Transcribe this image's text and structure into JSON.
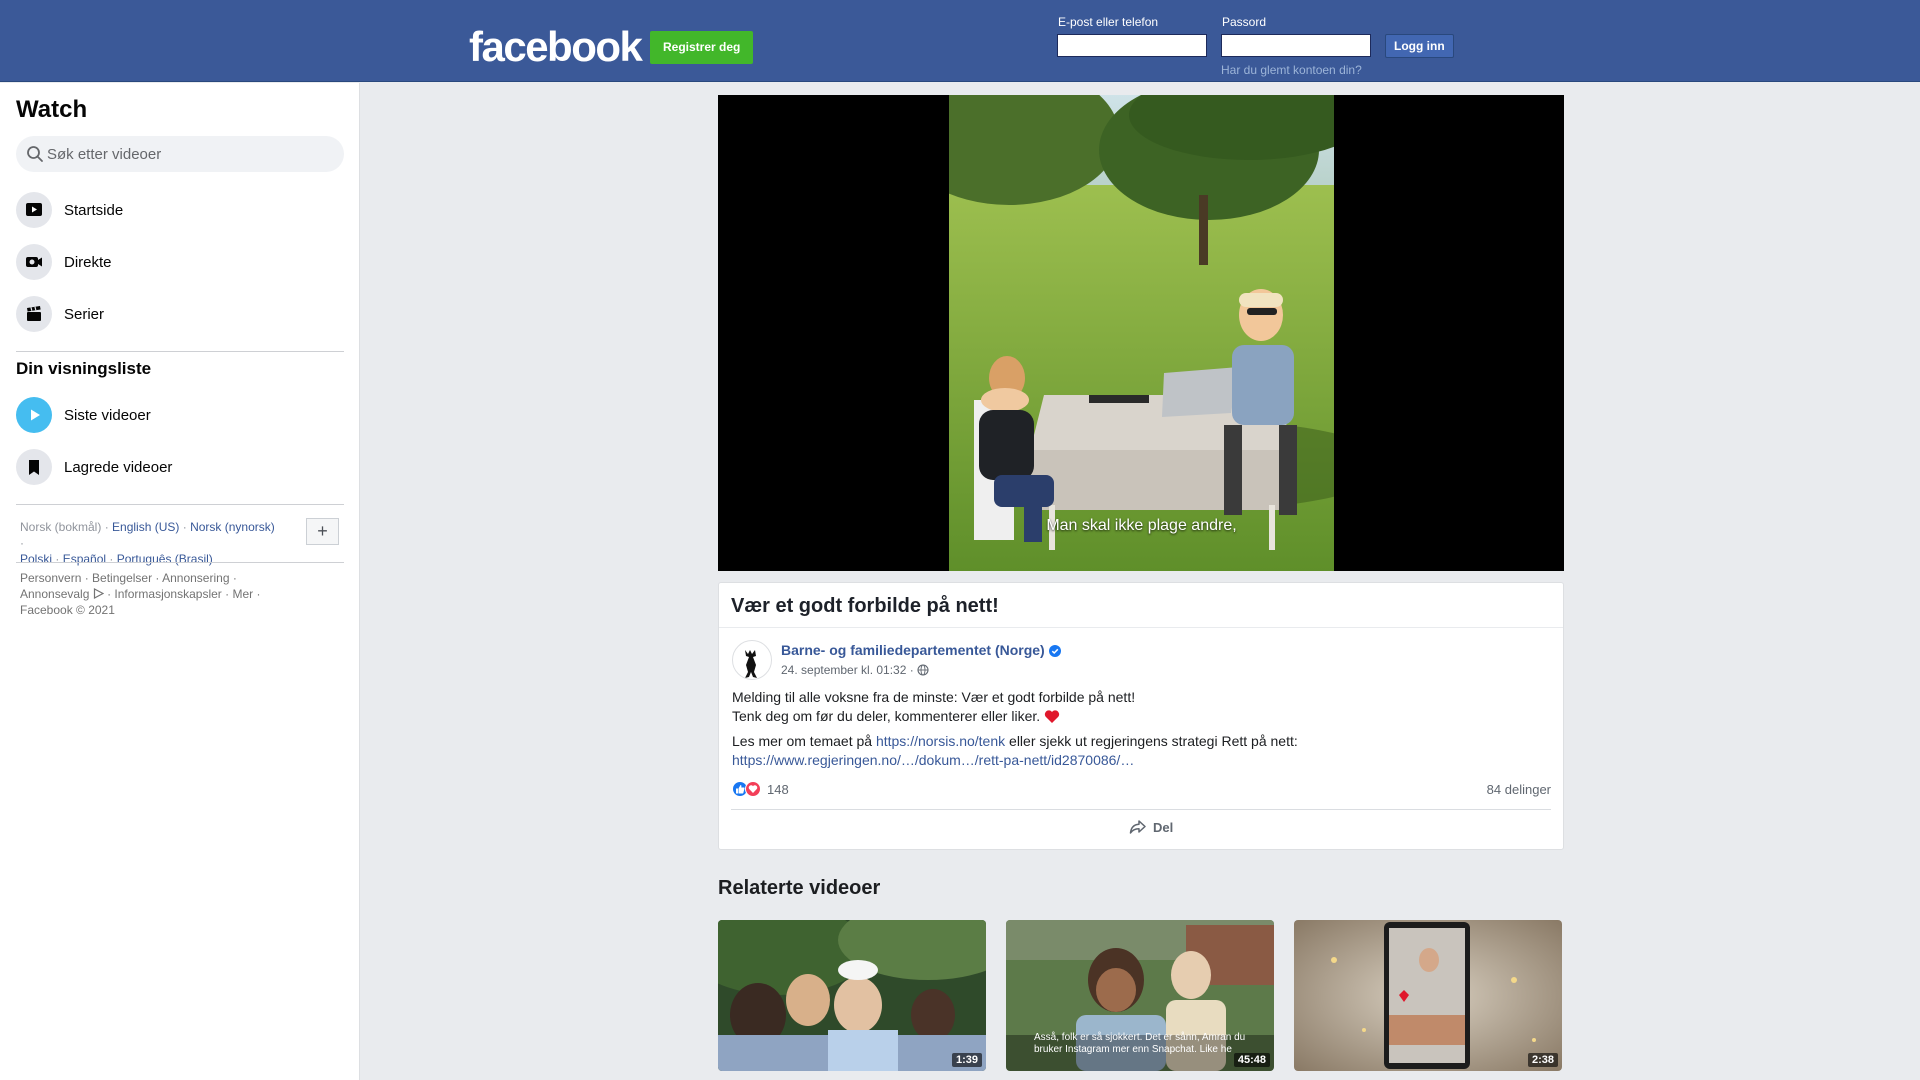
{
  "header": {
    "logo": "facebook",
    "register_label": "Registrer deg",
    "email_label": "E-post eller telefon",
    "password_label": "Passord",
    "login_label": "Logg inn",
    "forgot_label": "Har du glemt kontoen din?",
    "bg_color": "#3b5998"
  },
  "sidebar": {
    "title": "Watch",
    "search_placeholder": "Søk etter videoer",
    "nav": [
      {
        "label": "Startside",
        "icon": "play-screen-icon"
      },
      {
        "label": "Direkte",
        "icon": "live-camera-icon"
      },
      {
        "label": "Serier",
        "icon": "clapperboard-icon"
      }
    ],
    "watchlist_title": "Din visningsliste",
    "watchlist": [
      {
        "label": "Siste videoer",
        "icon": "play-circle-icon"
      },
      {
        "label": "Lagrede videoer",
        "icon": "bookmark-icon"
      }
    ],
    "languages": {
      "current": "Norsk (bokmål)",
      "links": [
        "English (US)",
        "Norsk (nynorsk)",
        "Polski",
        "Español",
        "Português (Brasil)"
      ],
      "more": "+"
    },
    "footer": [
      "Personvern",
      "Betingelser",
      "Annonsering",
      "Annonsevalg",
      "Informasjonskapsler",
      "Mer"
    ],
    "copyright": "Facebook © 2021"
  },
  "video": {
    "caption": "Man skal ikke plage andre,"
  },
  "post": {
    "title": "Vær et godt forbilde på nett!",
    "page_name": "Barne- og familiedepartementet (Norge)",
    "date": "24. september kl. 01:32 ·",
    "line1": "Melding til alle voksne fra de minste: Vær et godt forbilde på nett!",
    "line2": "Tenk deg om før du deler, kommenterer eller liker.",
    "line3_prefix": "Les mer om temaet på",
    "link1": "https://norsis.no/tenk",
    "line3_suffix": "eller sjekk ut regjeringens strategi Rett på nett:",
    "link2": "https://www.regjeringen.no/…/dokum…/rett-pa-nett/id2870086/…",
    "reaction_count": "148",
    "shares": "84 delinger",
    "share_label": "Del"
  },
  "related": {
    "title": "Relaterte videoer",
    "videos": [
      {
        "duration": "1:39"
      },
      {
        "duration": "45:48",
        "caption": "Asså, folk er så sjokkert. Det er sånn, Amran du bruker Instagram mer enn Snapchat. Like he"
      },
      {
        "duration": "2:38"
      }
    ]
  }
}
